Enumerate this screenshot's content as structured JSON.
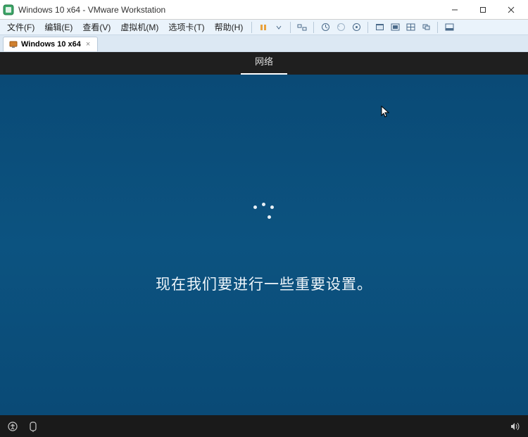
{
  "window": {
    "title": "Windows 10 x64 - VMware Workstation"
  },
  "menu": {
    "file": "文件(F)",
    "edit": "编辑(E)",
    "view": "查看(V)",
    "vm": "虚拟机(M)",
    "tabs": "选项卡(T)",
    "help": "帮助(H)"
  },
  "tab": {
    "label": "Windows 10 x64"
  },
  "oobe": {
    "header_tab": "网络",
    "message": "现在我们要进行一些重要设置。"
  },
  "icons": {
    "pause": "pause",
    "dropdown": "dropdown",
    "send_keys": "send-keys",
    "snapshot": "snapshot",
    "snapshot_manager": "snapshot-manager",
    "snapshot_revert": "snapshot-revert",
    "fullscreen": "fullscreen",
    "unity": "unity",
    "stretch": "stretch",
    "cycle": "cycle",
    "thumbnail": "thumbnail"
  }
}
